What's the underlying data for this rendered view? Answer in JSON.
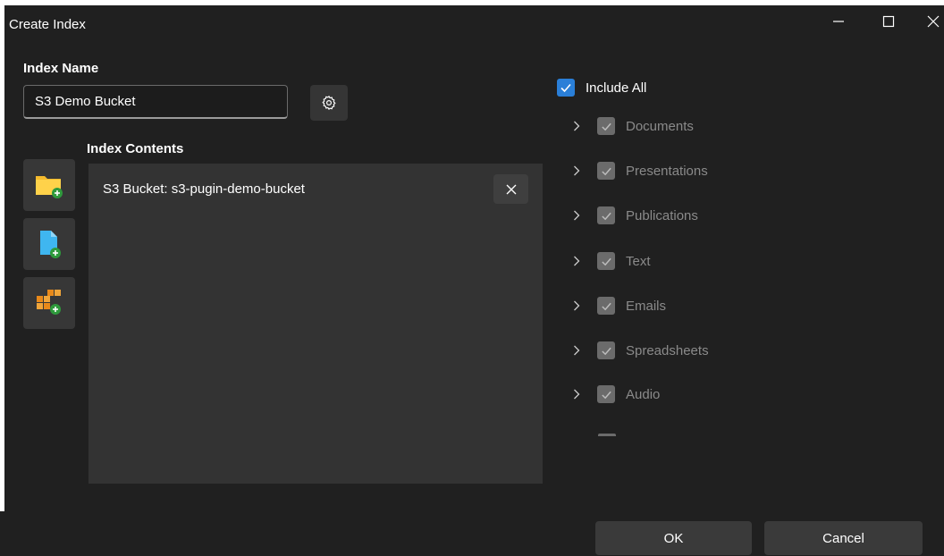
{
  "window": {
    "title": "Create Index",
    "controls": {
      "minimize": "—",
      "maximize": "☐",
      "close": "✕"
    }
  },
  "index_name": {
    "label": "Index Name",
    "value": "S3 Demo Bucket"
  },
  "index_contents": {
    "label": "Index Contents",
    "items": [
      {
        "text": "S3 Bucket: s3-pugin-demo-bucket"
      }
    ],
    "side_buttons": [
      "add-folder-icon",
      "add-file-icon",
      "add-s3-bucket-icon"
    ]
  },
  "filters": {
    "include_all": {
      "label": "Include All",
      "checked": true
    },
    "categories": [
      {
        "label": "Documents",
        "checked": true
      },
      {
        "label": "Presentations",
        "checked": true
      },
      {
        "label": "Publications",
        "checked": true
      },
      {
        "label": "Text",
        "checked": true
      },
      {
        "label": "Emails",
        "checked": true
      },
      {
        "label": "Spreadsheets",
        "checked": true
      },
      {
        "label": "Audio",
        "checked": true
      }
    ]
  },
  "buttons": {
    "ok": "OK",
    "cancel": "Cancel"
  },
  "colors": {
    "background": "#202020",
    "panel": "#333333",
    "accent": "#2a7fd8",
    "disabled_checkbox": "#6b6b6b",
    "disabled_text": "#8a8a8a"
  }
}
